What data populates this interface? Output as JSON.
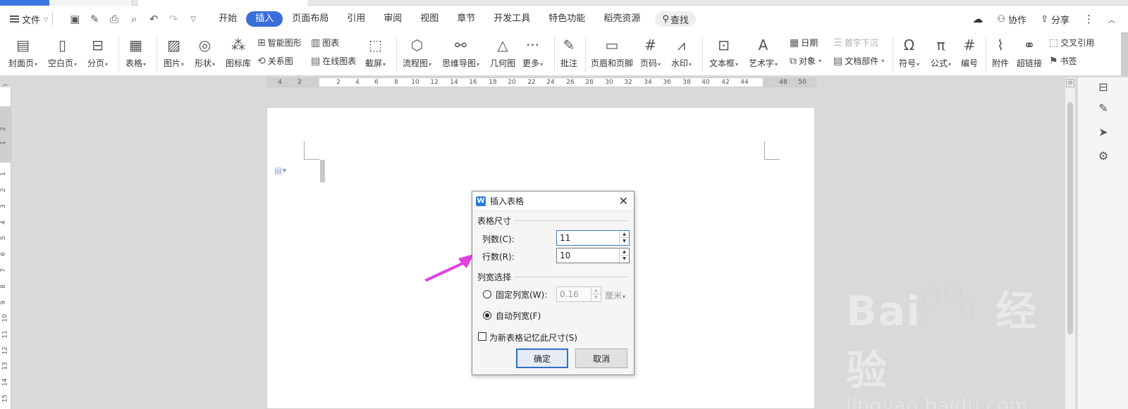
{
  "menubar": {
    "file_label": "文件",
    "tabs": [
      "开始",
      "插入",
      "页面布局",
      "引用",
      "审阅",
      "视图",
      "章节",
      "开发工具",
      "特色功能",
      "稻壳资源"
    ],
    "active_tab": "插入",
    "search_label": "查找",
    "right": {
      "collab": "协作",
      "share": "分享"
    }
  },
  "ribbon": {
    "cover": "封面页",
    "blank": "空白页",
    "pagebreak": "分页",
    "table": "表格",
    "picture": "图片",
    "shape": "形状",
    "iconlib": "图标库",
    "smartart": "智能图形",
    "relation": "关系图",
    "chart": "图表",
    "online_chart": "在线图表",
    "screenshot": "截屏",
    "flowchart": "流程图",
    "mindmap": "思维导图",
    "geometry": "几何图",
    "more": "更多",
    "comment": "批注",
    "header_footer": "页眉和页脚",
    "page_number": "页码",
    "watermark": "水印",
    "textbox": "文本框",
    "wordart": "艺术字",
    "date": "日期",
    "object": "对象",
    "dropcap": "首字下沉",
    "docparts": "文档部件",
    "symbol": "符号",
    "formula": "公式",
    "numbering": "编号",
    "attachment": "附件",
    "hyperlink": "超链接",
    "crossref": "交叉引用",
    "bookmark": "书签"
  },
  "hruler": {
    "numbers": [
      "4",
      "2",
      "2",
      "4",
      "6",
      "8",
      "10",
      "12",
      "14",
      "16",
      "18",
      "20",
      "22",
      "24",
      "26",
      "28",
      "30",
      "32",
      "34",
      "36",
      "38",
      "40",
      "42",
      "44",
      "48",
      "50"
    ]
  },
  "vruler": {
    "numbers": [
      "2",
      "1",
      "1",
      "2",
      "3",
      "4",
      "5",
      "6",
      "7",
      "8",
      "9",
      "10",
      "11",
      "12",
      "13",
      "14",
      "15"
    ]
  },
  "dialog": {
    "title": "插入表格",
    "size_section": "表格尺寸",
    "cols_label": "列数(C):",
    "cols_value": "11",
    "rows_label": "行数(R):",
    "rows_value": "10",
    "width_section": "列宽选择",
    "fixed_label": "固定列宽(W):",
    "fixed_value": "0.16",
    "unit": "厘米",
    "auto_label": "自动列宽(F)",
    "remember_label": "为新表格记忆此尺寸(S)",
    "ok": "确定",
    "cancel": "取消"
  },
  "watermark": {
    "brand": "Bai",
    "brand2": "经验",
    "url": "jingyan.baidu.com"
  },
  "colors": {
    "accent": "#3a6ed8",
    "arrow": "#e040e0"
  }
}
